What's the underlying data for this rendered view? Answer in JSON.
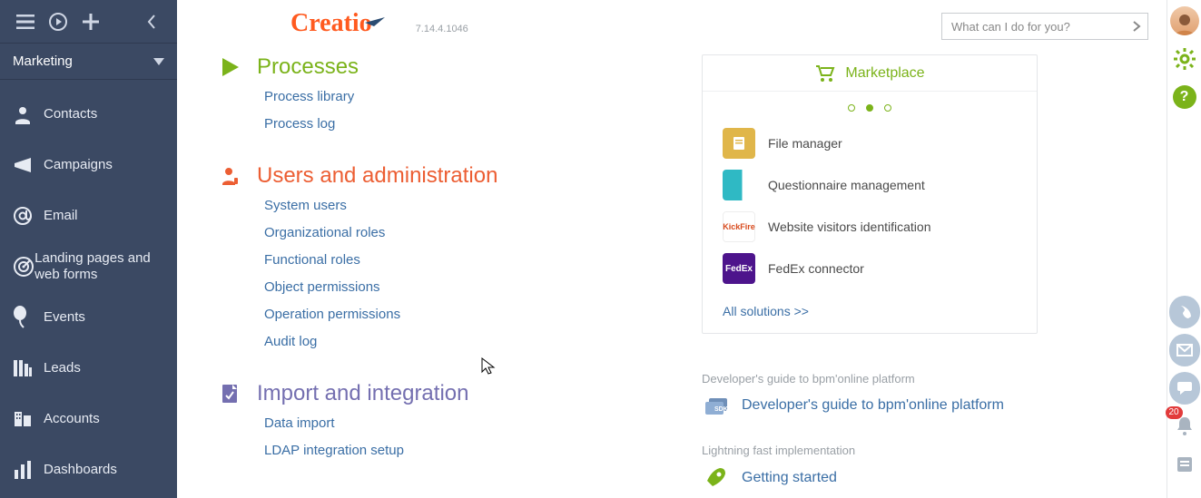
{
  "brand": {
    "name": "Creatio",
    "version": "7.14.4.1046"
  },
  "search": {
    "placeholder": "What can I do for you?"
  },
  "workplace": {
    "label": "Marketing"
  },
  "sidebar": {
    "items": [
      {
        "label": "Contacts"
      },
      {
        "label": "Campaigns"
      },
      {
        "label": "Email"
      },
      {
        "label": "Landing pages and web forms"
      },
      {
        "label": "Events"
      },
      {
        "label": "Leads"
      },
      {
        "label": "Accounts"
      },
      {
        "label": "Dashboards"
      }
    ]
  },
  "sections": {
    "processes": {
      "title": "Processes",
      "links": [
        "Process library",
        "Process log"
      ]
    },
    "users": {
      "title": "Users and administration",
      "links": [
        "System users",
        "Organizational roles",
        "Functional roles",
        "Object permissions",
        "Operation permissions",
        "Audit log"
      ]
    },
    "import": {
      "title": "Import and integration",
      "links": [
        "Data import",
        "LDAP integration setup"
      ]
    }
  },
  "marketplace": {
    "title": "Marketplace",
    "items": [
      {
        "label": "File manager"
      },
      {
        "label": "Questionnaire management"
      },
      {
        "label": "Website visitors identification"
      },
      {
        "label": "FedEx connector"
      }
    ],
    "all": "All solutions >>"
  },
  "dev_guide": {
    "subtitle": "Developer's guide to bpm'online platform",
    "link": "Developer's guide to bpm'online platform"
  },
  "getting_started": {
    "subtitle": "Lightning fast implementation",
    "link": "Getting started"
  },
  "rail": {
    "help": "?",
    "badge": "20"
  },
  "thumb_labels": {
    "kickfire": "KickFire",
    "fedex": "FedEx"
  }
}
